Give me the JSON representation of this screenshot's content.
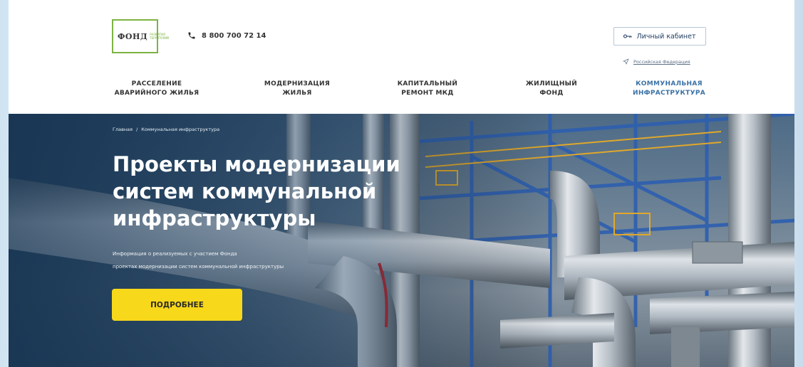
{
  "header": {
    "logo_text": "ФОНД",
    "logo_subtext": "РАЗВИТИЯ ТЕРРИТОРИЙ",
    "phone": "8 800 700 72 14",
    "cabinet_label": "Личный кабинет",
    "region_label": "Российская Федерация"
  },
  "nav": {
    "items": [
      {
        "line1": "РАССЕЛЕНИЕ",
        "line2": "АВАРИЙНОГО ЖИЛЬЯ"
      },
      {
        "line1": "МОДЕРНИЗАЦИЯ",
        "line2": "ЖИЛЬЯ"
      },
      {
        "line1": "КАПИТАЛЬНЫЙ",
        "line2": "РЕМОНТ МКД"
      },
      {
        "line1": "ЖИЛИЩНЫЙ",
        "line2": "ФОНД"
      },
      {
        "line1": "КОММУНАЛЬНАЯ",
        "line2": "ИНФРАСТРУКТУРА"
      }
    ]
  },
  "hero": {
    "breadcrumb": {
      "home": "Главная",
      "separator": "/",
      "current": "Коммунальная инфраструктура"
    },
    "title_line1": "Проекты модернизации",
    "title_line2": "систем коммунальной",
    "title_line3": "инфраструктуры",
    "desc_line1": "Информация о реализуемых с участием Фонда",
    "desc_line2": "проектах модернизации систем коммунальной инфраструктуры",
    "cta_label": "ПОДРОБНЕЕ"
  },
  "colors": {
    "accent": "#f7d81a",
    "nav_active": "#3a72a6",
    "logo_border": "#7cb342"
  }
}
